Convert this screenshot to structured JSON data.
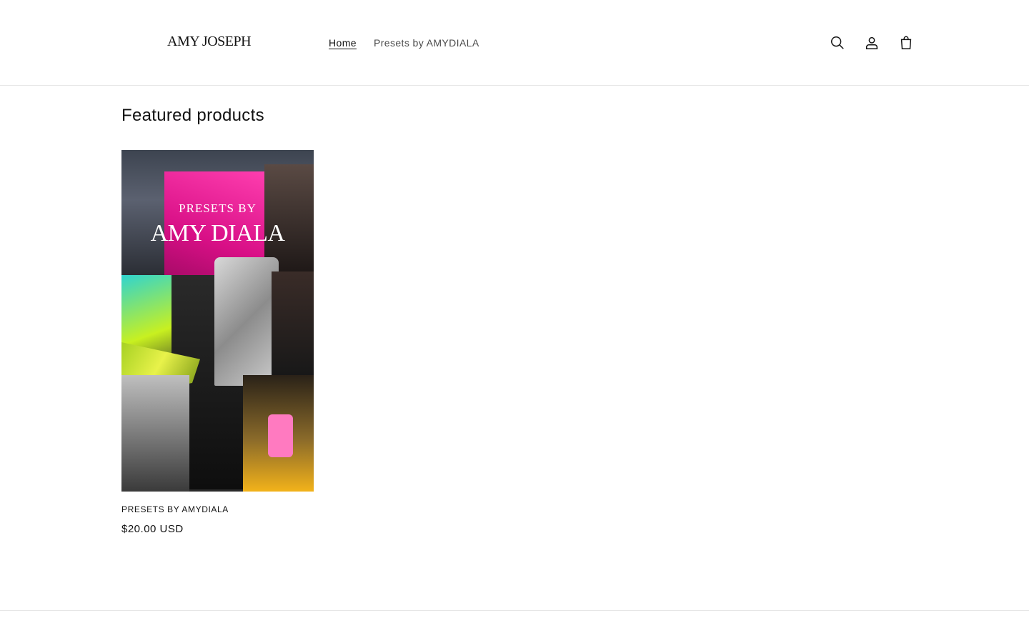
{
  "header": {
    "logo": "AMY JOSEPH",
    "nav": [
      {
        "label": "Home",
        "active": true
      },
      {
        "label": "Presets by AMYDIALA",
        "active": false
      }
    ],
    "icons": [
      "search-icon",
      "account-icon",
      "cart-icon"
    ]
  },
  "featured": {
    "title": "Featured products",
    "products": [
      {
        "name": "PRESETS BY AMYDIALA",
        "price": "$20.00 USD",
        "image_text_small": "PRESETS BY",
        "image_text_large": "AMY DIALA"
      }
    ]
  },
  "colors": {
    "text": "#121212",
    "muted": "#4a4a4a",
    "border": "#e6e6e6",
    "accent_pink": "#e0148c"
  }
}
